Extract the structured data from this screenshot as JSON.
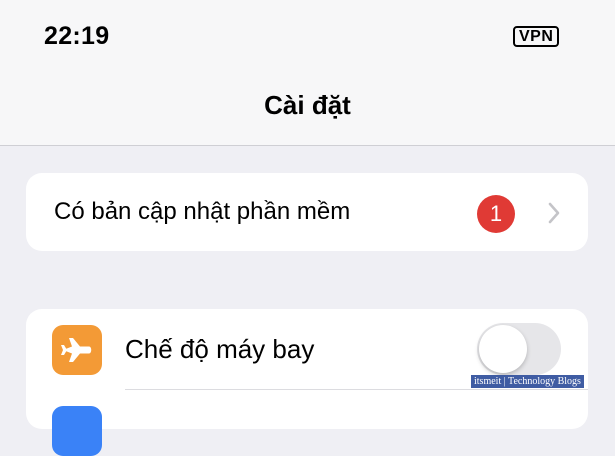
{
  "status_bar": {
    "time": "22:19",
    "vpn_label": "VPN"
  },
  "nav": {
    "title": "Cài đặt"
  },
  "update_row": {
    "label": "Có bản cập nhật phần mềm",
    "badge_count": "1",
    "badge_color": "#e03a35"
  },
  "settings_rows": [
    {
      "label": "Chế độ máy bay",
      "icon": "airplane-icon",
      "icon_color": "#f39a36",
      "toggle_on": false
    }
  ],
  "watermark": {
    "text": "itsmeit | Technology Blogs"
  }
}
